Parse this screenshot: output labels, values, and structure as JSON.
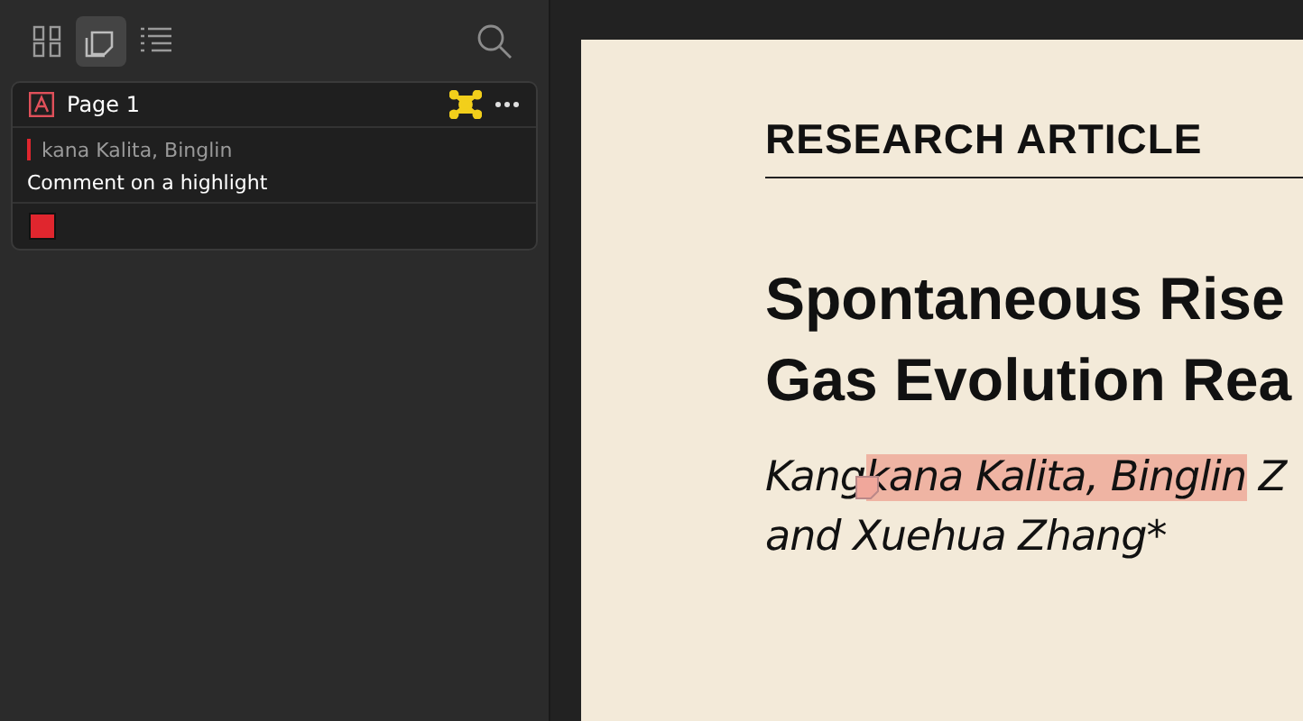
{
  "toolbar": {
    "view_buttons": [
      {
        "kind": "grid",
        "selected": false
      },
      {
        "kind": "annotations",
        "selected": true
      },
      {
        "kind": "outline",
        "selected": false
      }
    ]
  },
  "annotation": {
    "page": "Page 1",
    "quote": "kana Kalita, Binglin",
    "comment": "Comment on a highlight",
    "color": "#e0262e"
  },
  "document": {
    "section": "RESEARCH ARTICLE",
    "title_lines": [
      "Spontaneous Rise",
      "Gas Evolution Rea"
    ],
    "author_line_1": {
      "before": "Kang",
      "highlighted": "kana Kalita, Binglin",
      "after": " Z"
    },
    "author_line_2": "and Xuehua Zhang*"
  }
}
